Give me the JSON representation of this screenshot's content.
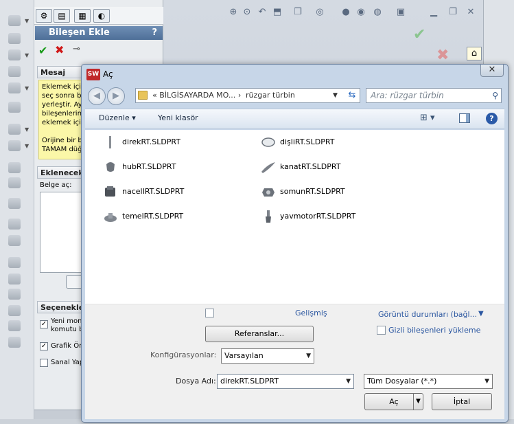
{
  "background": {
    "property_manager": {
      "title": "Bileşen Ekle",
      "help": "?",
      "sections": {
        "message": "Mesaj",
        "to_insert": "Eklenecek",
        "options": "Seçenekle"
      },
      "message_lines": [
        "Eklemek için",
        "seç sonra bi",
        "yerleştir. Ay",
        "bileşenlerin",
        "eklemek için",
        "",
        "Orijine bir bi",
        "TAMAM düğ"
      ],
      "open_doc_label": "Belge aç:",
      "options": [
        {
          "label": "Yeni mont",
          "label2": "komutu b",
          "checked": true
        },
        {
          "label": "Grafik Öni",
          "checked": true
        },
        {
          "label": "Sanal Yap",
          "checked": false
        }
      ]
    }
  },
  "dialog": {
    "title": "Aç",
    "app_icon": "SW",
    "close": "✕",
    "address": {
      "prefix": "«",
      "crumb1": "BİLGİSAYARDA MO...",
      "crumb2": "rüzgar türbin",
      "separator": "›"
    },
    "search_placeholder": "Ara: rüzgar türbin",
    "toolbar": {
      "organize": "Düzenle ▾",
      "new_folder": "Yeni klasör"
    },
    "files": [
      {
        "name": "direkRT.SLDPRT",
        "icon": "rod-part-icon"
      },
      {
        "name": "dişliRT.SLDPRT",
        "icon": "ring-part-icon"
      },
      {
        "name": "hubRT.SLDPRT",
        "icon": "hub-part-icon"
      },
      {
        "name": "kanatRT.SLDPRT",
        "icon": "blade-part-icon"
      },
      {
        "name": "nacelIRT.SLDPRT",
        "icon": "nacelle-part-icon"
      },
      {
        "name": "somunRT.SLDPRT",
        "icon": "nut-part-icon"
      },
      {
        "name": "temelRT.SLDPRT",
        "icon": "base-part-icon"
      },
      {
        "name": "yavmotorRT.SLDPRT",
        "icon": "motor-part-icon"
      }
    ],
    "advanced_label": "Gelişmiş",
    "display_states": "Görüntü durumları (bağl...",
    "hidden_components_label": "Gizli bileşenleri yükleme",
    "references_button": "Referanslar...",
    "configurations_label": "Konfigürasyonlar:",
    "configuration_value": "Varsayılan",
    "filename_label": "Dosya Adı:",
    "filename_value": "direkRT.SLDPRT",
    "file_type_value": "Tüm Dosyalar (*.*)",
    "open_button": "Aç",
    "cancel_button": "İptal"
  },
  "colors": {
    "dialog_frame": "#c7d6e8",
    "link_blue": "#2a56a0",
    "message_yellow": "#fbf7a8"
  }
}
